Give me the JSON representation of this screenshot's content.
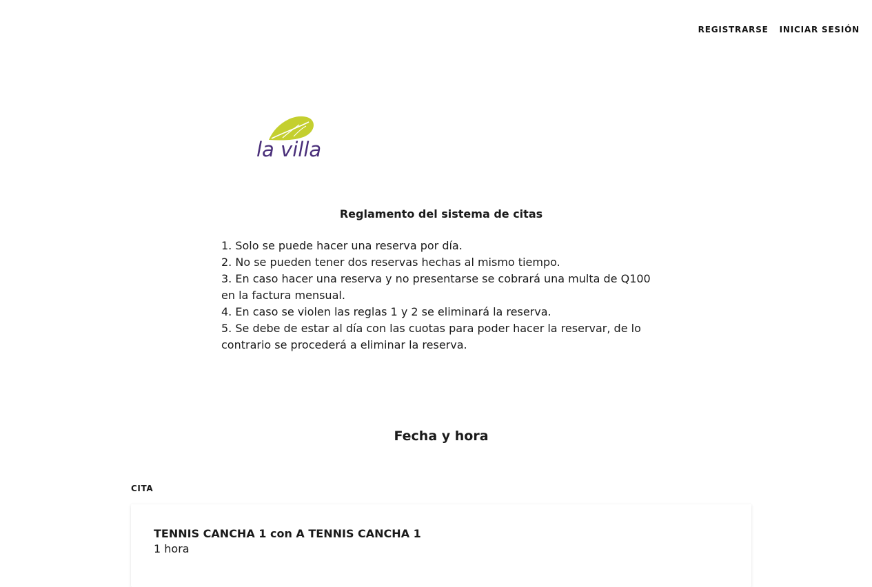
{
  "nav": {
    "register": "REGISTRARSE",
    "login": "INICIAR SESIÓN"
  },
  "logo": {
    "text": "la villa",
    "leaf_color": "#c4cf2f",
    "text_color": "#4a2f7a"
  },
  "rules": {
    "title": "Reglamento del sistema de citas",
    "items": [
      "1. Solo se puede hacer una reserva por día.",
      "2. No se pueden tener dos reservas hechas al mismo tiempo.",
      "3. En caso hacer una reserva y no presentarse se cobrará una multa de Q100 en la factura mensual.",
      "4. En caso se violen las reglas 1 y 2 se eliminará la reserva.",
      "5. Se debe de estar al día con las cuotas para poder hacer la reservar, de lo contrario se procederá a eliminar la reserva."
    ]
  },
  "section": {
    "title": "Fecha y hora"
  },
  "appointment": {
    "label": "CITA",
    "title": "TENNIS CANCHA 1 con A TENNIS CANCHA 1",
    "duration": "1 hora"
  }
}
